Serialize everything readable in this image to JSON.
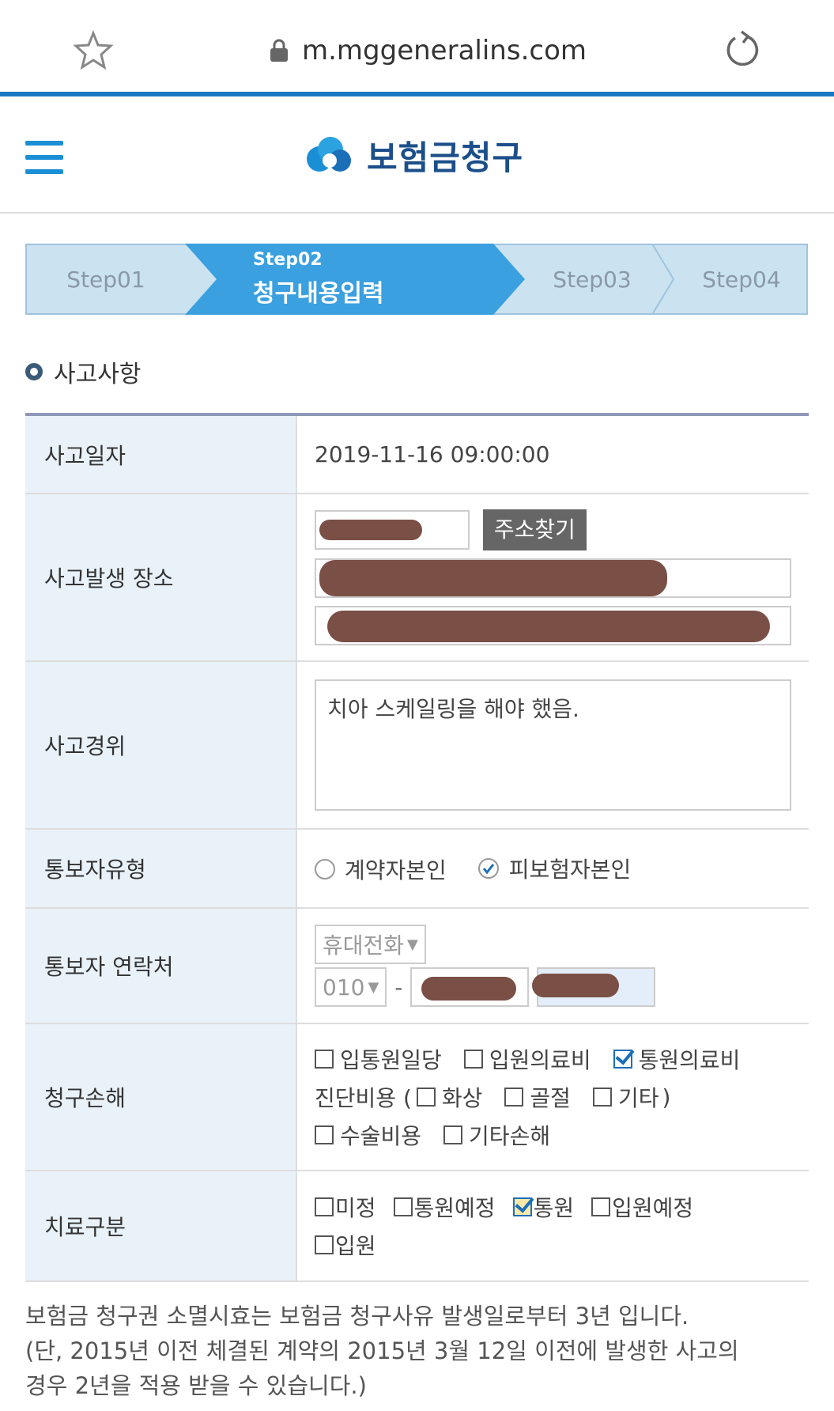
{
  "browser": {
    "url": "m.mggeneralins.com"
  },
  "header": {
    "title": "보험금청구"
  },
  "steps": [
    {
      "label": "Step01"
    },
    {
      "label": "Step02",
      "sublabel": "청구내용입력"
    },
    {
      "label": "Step03"
    },
    {
      "label": "Step04"
    }
  ],
  "section": {
    "title": "사고사항"
  },
  "form": {
    "accident_date": {
      "label": "사고일자",
      "value": "2019-11-16 09:00:00"
    },
    "accident_place": {
      "label": "사고발생 장소",
      "button": "주소찾기"
    },
    "accident_detail": {
      "label": "사고경위",
      "value": "치아 스케일링을 해야 했음."
    },
    "reporter_type": {
      "label": "통보자유형",
      "options": [
        "계약자본인",
        "피보험자본인"
      ],
      "selected": "피보험자본인"
    },
    "reporter_contact": {
      "label": "통보자 연락처",
      "phone_type": "휴대전화",
      "prefix": "010",
      "dash": "-"
    },
    "claim_damage": {
      "label": "청구손해",
      "line1": [
        {
          "label": "입통원일당",
          "checked": false
        },
        {
          "label": "입원의료비",
          "checked": false
        },
        {
          "label": "통원의료비",
          "checked": true
        }
      ],
      "line2_prefix": "진단비용 (",
      "line2": [
        {
          "label": "화상",
          "checked": false
        },
        {
          "label": "골절",
          "checked": false
        },
        {
          "label": "기타",
          "checked": false
        }
      ],
      "line2_suffix": ")",
      "line3": [
        {
          "label": "수술비용",
          "checked": false
        },
        {
          "label": "기타손해",
          "checked": false
        }
      ]
    },
    "treatment_type": {
      "label": "치료구분",
      "line1": [
        {
          "label": "미정",
          "checked": false
        },
        {
          "label": "통원예정",
          "checked": false
        },
        {
          "label": "통원",
          "checked": true
        },
        {
          "label": "입원예정",
          "checked": false
        }
      ],
      "line2": [
        {
          "label": "입원",
          "checked": false
        }
      ]
    }
  },
  "footer": {
    "note1": "보험금 청구권 소멸시효는 보험금 청구사유 발생일로부터 3년 입니다.",
    "note2": "(단, 2015년 이전 체결된 계약의 2015년 3월 12일 이전에 발생한 사고의",
    "note3": "경우 2년을 적용 받을 수 있습니다.)"
  },
  "colors": {
    "accent": "#1a78c2",
    "step_bg": "#cbe2f1",
    "step_active": "#3aa0e0",
    "label_bg": "#e9f2f9",
    "redaction": "#7a4f45"
  }
}
